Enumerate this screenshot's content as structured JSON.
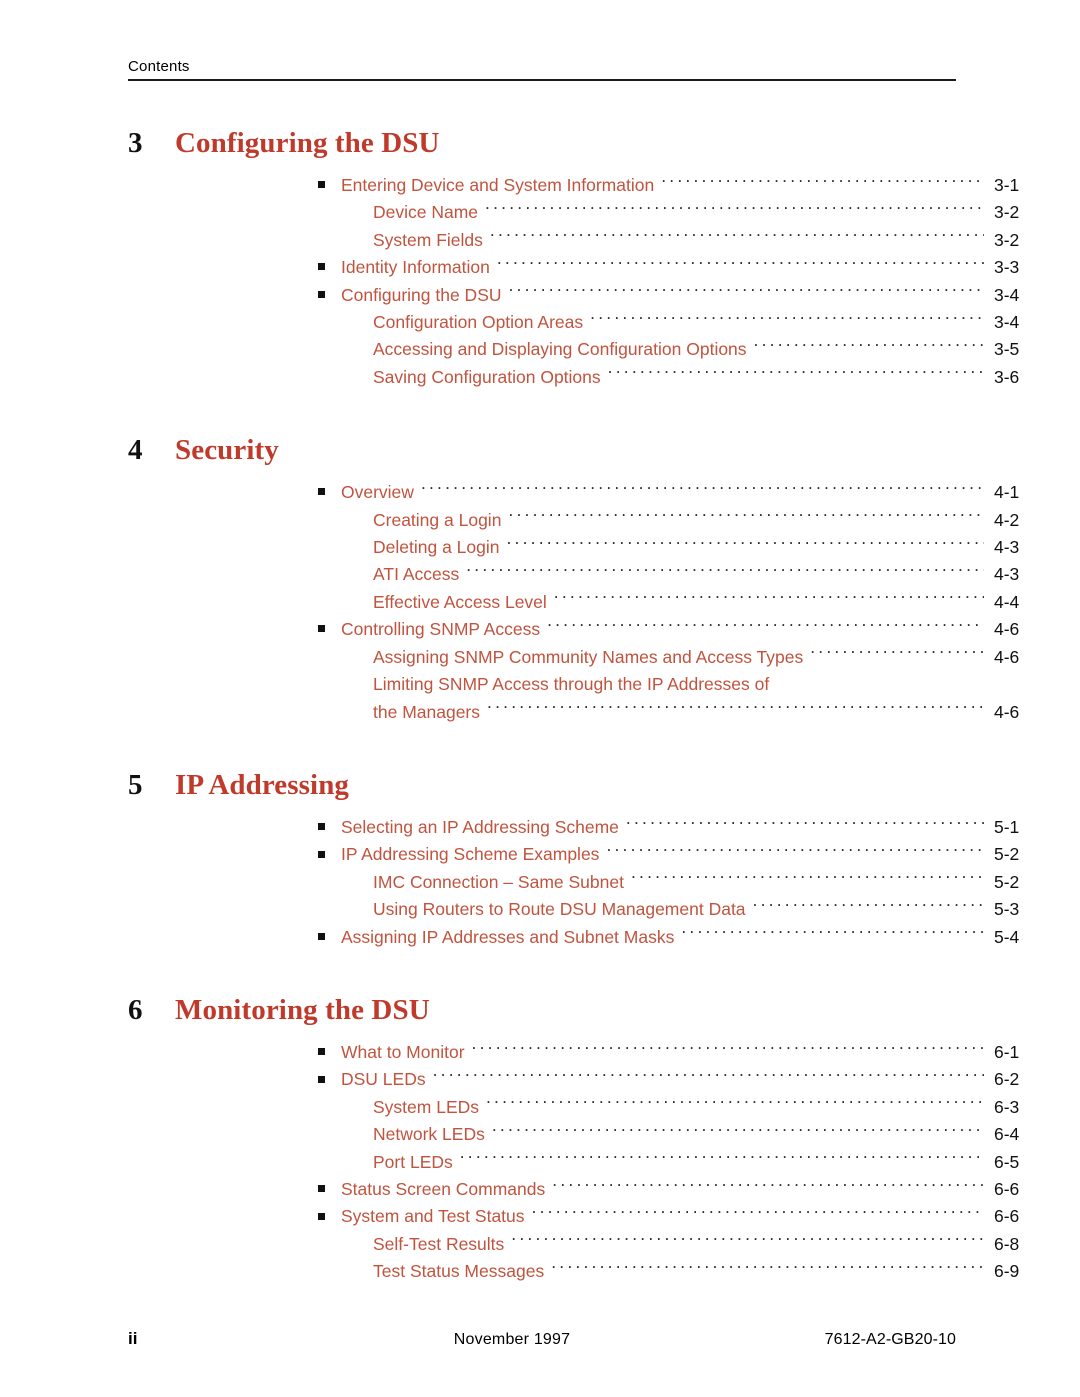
{
  "running_head": {
    "label": "Contents"
  },
  "colors": {
    "heading_red": "#bf3a2b",
    "entry_red": "#c0543f",
    "text_black": "#111111"
  },
  "chapters": [
    {
      "number": "3",
      "title": "Configuring the DSU",
      "entries": [
        {
          "level": 1,
          "label": "Entering Device and System Information",
          "page": "3-1"
        },
        {
          "level": 2,
          "label": "Device Name",
          "page": "3-2"
        },
        {
          "level": 2,
          "label": "System Fields",
          "page": "3-2"
        },
        {
          "level": 1,
          "label": "Identity Information",
          "page": "3-3"
        },
        {
          "level": 1,
          "label": "Configuring the DSU",
          "page": "3-4"
        },
        {
          "level": 2,
          "label": "Configuration Option Areas",
          "page": "3-4"
        },
        {
          "level": 2,
          "label": "Accessing and Displaying Configuration Options",
          "page": "3-5"
        },
        {
          "level": 2,
          "label": "Saving Configuration Options",
          "page": "3-6"
        }
      ]
    },
    {
      "number": "4",
      "title": "Security",
      "entries": [
        {
          "level": 1,
          "label": "Overview",
          "page": "4-1"
        },
        {
          "level": 2,
          "label": "Creating a Login",
          "page": "4-2"
        },
        {
          "level": 2,
          "label": "Deleting a Login",
          "page": "4-3"
        },
        {
          "level": 2,
          "label": "ATI Access",
          "page": "4-3"
        },
        {
          "level": 2,
          "label": "Effective Access Level",
          "page": "4-4"
        },
        {
          "level": 1,
          "label": "Controlling SNMP Access",
          "page": "4-6"
        },
        {
          "level": 2,
          "label": "Assigning SNMP Community Names and Access Types",
          "page": "4-6"
        },
        {
          "level": 2,
          "label": "Limiting SNMP Access through the IP Addresses of",
          "page": "",
          "wrap_first": true
        },
        {
          "level": 2,
          "label": "the Managers",
          "page": "4-6"
        }
      ]
    },
    {
      "number": "5",
      "title": "IP Addressing",
      "entries": [
        {
          "level": 1,
          "label": "Selecting an IP Addressing Scheme",
          "page": "5-1"
        },
        {
          "level": 1,
          "label": "IP Addressing Scheme Examples",
          "page": "5-2"
        },
        {
          "level": 2,
          "label": "IMC Connection – Same Subnet",
          "page": "5-2"
        },
        {
          "level": 2,
          "label": "Using Routers to Route DSU Management Data",
          "page": "5-3"
        },
        {
          "level": 1,
          "label": "Assigning IP Addresses and Subnet Masks",
          "page": "5-4"
        }
      ]
    },
    {
      "number": "6",
      "title": "Monitoring the DSU",
      "entries": [
        {
          "level": 1,
          "label": "What to Monitor",
          "page": "6-1"
        },
        {
          "level": 1,
          "label": "DSU LEDs",
          "page": "6-2"
        },
        {
          "level": 2,
          "label": "System LEDs",
          "page": "6-3"
        },
        {
          "level": 2,
          "label": "Network LEDs",
          "page": "6-4"
        },
        {
          "level": 2,
          "label": "Port LEDs",
          "page": "6-5"
        },
        {
          "level": 1,
          "label": "Status Screen Commands",
          "page": "6-6"
        },
        {
          "level": 1,
          "label": "System and Test Status",
          "page": "6-6"
        },
        {
          "level": 2,
          "label": "Self-Test Results",
          "page": "6-8"
        },
        {
          "level": 2,
          "label": "Test Status Messages",
          "page": "6-9"
        }
      ]
    }
  ],
  "footer": {
    "page_label": "ii",
    "date": "November 1997",
    "doc_number": "7612-A2-GB20-10"
  }
}
